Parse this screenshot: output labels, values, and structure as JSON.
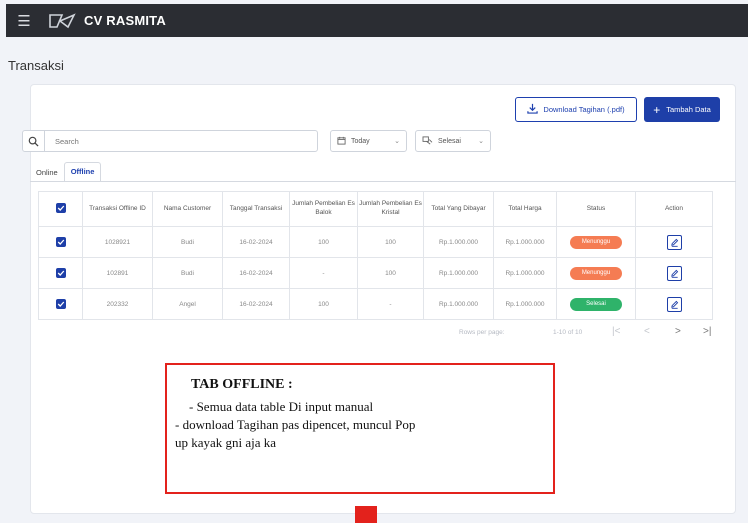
{
  "app": {
    "name": "CV RASMITA"
  },
  "page": {
    "title": "Transaksi"
  },
  "actions": {
    "download_label": "Download Tagihan (.pdf)",
    "add_label": "Tambah Data"
  },
  "search": {
    "placeholder": "Search"
  },
  "filters": {
    "date_value": "Today",
    "status_value": "Selesai"
  },
  "tabs": [
    {
      "label": "Online",
      "active": false
    },
    {
      "label": "Offline",
      "active": true
    }
  ],
  "table": {
    "headers": [
      "",
      "Transaksi Offline ID",
      "Nama Customer",
      "Tanggal Transaksi",
      "Jumlah Pembelian Es Balok",
      "Jumlah Pembelian Es Kristal",
      "Total Yang Dibayar",
      "Total Harga",
      "Status",
      "Action"
    ],
    "rows": [
      {
        "id": "1028921",
        "customer": "Budi",
        "date": "16-02-2024",
        "es_balok": "100",
        "es_kristal": "100",
        "dibayar": "Rp.1.000.000",
        "harga": "Rp.1.000.000",
        "status": "Menunggu",
        "status_color": "#f57c53"
      },
      {
        "id": "102891",
        "customer": "Budi",
        "date": "16-02-2024",
        "es_balok": "-",
        "es_kristal": "100",
        "dibayar": "Rp.1.000.000",
        "harga": "Rp.1.000.000",
        "status": "Menunggu",
        "status_color": "#f57c53"
      },
      {
        "id": "202332",
        "customer": "Angel",
        "date": "16-02-2024",
        "es_balok": "100",
        "es_kristal": "-",
        "dibayar": "Rp.1.000.000",
        "harga": "Rp.1.000.000",
        "status": "Selesai",
        "status_color": "#2fb36a"
      }
    ]
  },
  "pagination": {
    "rows_per_page_label": "Rows per page:",
    "range": "1-10 of 10"
  },
  "note": {
    "title": "TAB OFFLINE :",
    "line1": "-  Semua data table Di input manual",
    "line2": "- download Tagihan pas dipencet, muncul Pop",
    "line3": "up kayak gni aja ka"
  },
  "icons": [
    "hamburger-icon",
    "logo-icon",
    "download-icon",
    "plus-icon",
    "search-icon",
    "calendar-icon",
    "status-icon",
    "chevron-down-icon",
    "checkbox-icon",
    "edit-icon",
    "first-page-icon",
    "prev-page-icon",
    "next-page-icon",
    "last-page-icon"
  ],
  "colors": {
    "primary": "#1e3fa8",
    "topbar": "#2b2d33",
    "pending": "#f57c53",
    "done": "#2fb36a",
    "annotation": "#e3221c"
  }
}
